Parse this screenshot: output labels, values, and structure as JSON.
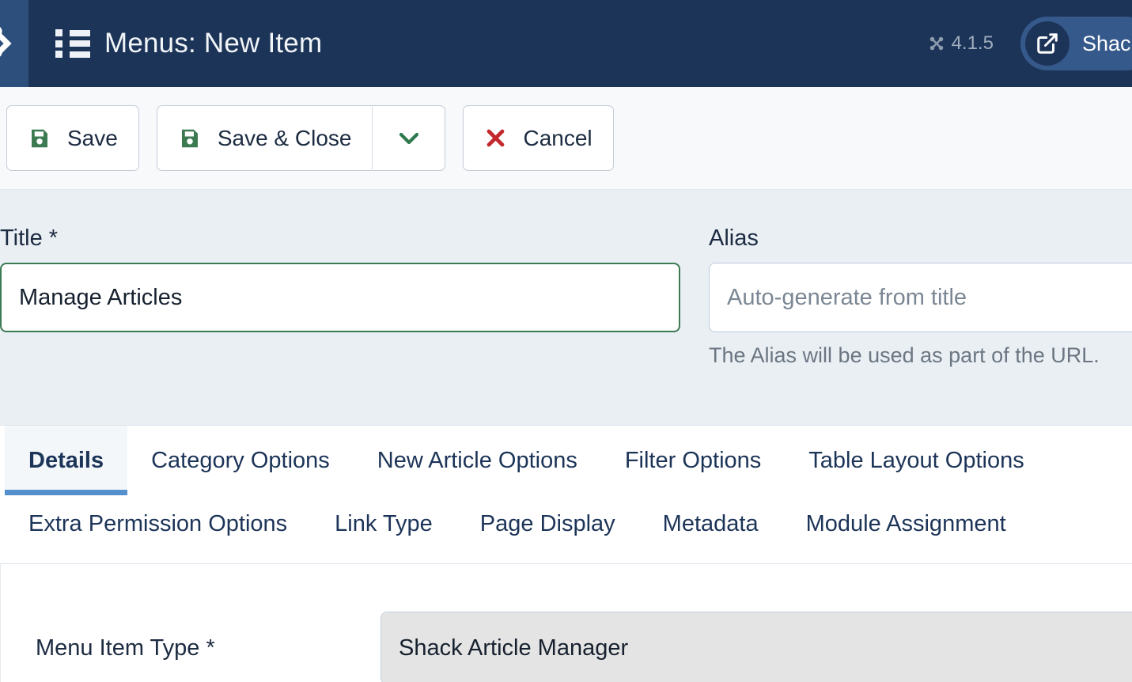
{
  "header": {
    "logo_icon": "joomla-logo-icon",
    "menu_icon": "list-icon",
    "title": "Menus: New Item",
    "version_icon": "joomla-icon",
    "version": "4.1.5",
    "preview": {
      "icon": "external-link-icon",
      "label": "Shack"
    }
  },
  "toolbar": {
    "save_label": "Save",
    "save_icon": "save-icon",
    "save_close_label": "Save & Close",
    "save_close_icon": "save-icon",
    "dropdown_icon": "chevron-down-icon",
    "cancel_label": "Cancel",
    "cancel_icon": "close-x-icon"
  },
  "form": {
    "title_label": "Title *",
    "title_value": "Manage Articles",
    "title_placeholder": "",
    "alias_label": "Alias",
    "alias_value": "",
    "alias_placeholder": "Auto-generate from title",
    "alias_help": "The Alias will be used as part of the URL."
  },
  "tabs": {
    "row1": [
      {
        "label": "Details",
        "active": true
      },
      {
        "label": "Category Options",
        "active": false
      },
      {
        "label": "New Article Options",
        "active": false
      },
      {
        "label": "Filter Options",
        "active": false
      },
      {
        "label": "Table Layout Options",
        "active": false
      }
    ],
    "row2": [
      {
        "label": "Extra Permission Options",
        "active": false
      },
      {
        "label": "Link Type",
        "active": false
      },
      {
        "label": "Page Display",
        "active": false
      },
      {
        "label": "Metadata",
        "active": false
      },
      {
        "label": "Module Assignment",
        "active": false
      }
    ]
  },
  "panel": {
    "menu_item_type_label": "Menu Item Type *",
    "menu_item_type_value": "Shack Article Manager"
  },
  "colors": {
    "header_bg": "#1c3458",
    "sidebar_bg": "#2c4f7c",
    "form_bg": "#eaeff4",
    "accent_blue": "#5490cd",
    "save_green": "#3c7a52",
    "cancel_red": "#c3282c",
    "pill_blue": "#36598c"
  }
}
